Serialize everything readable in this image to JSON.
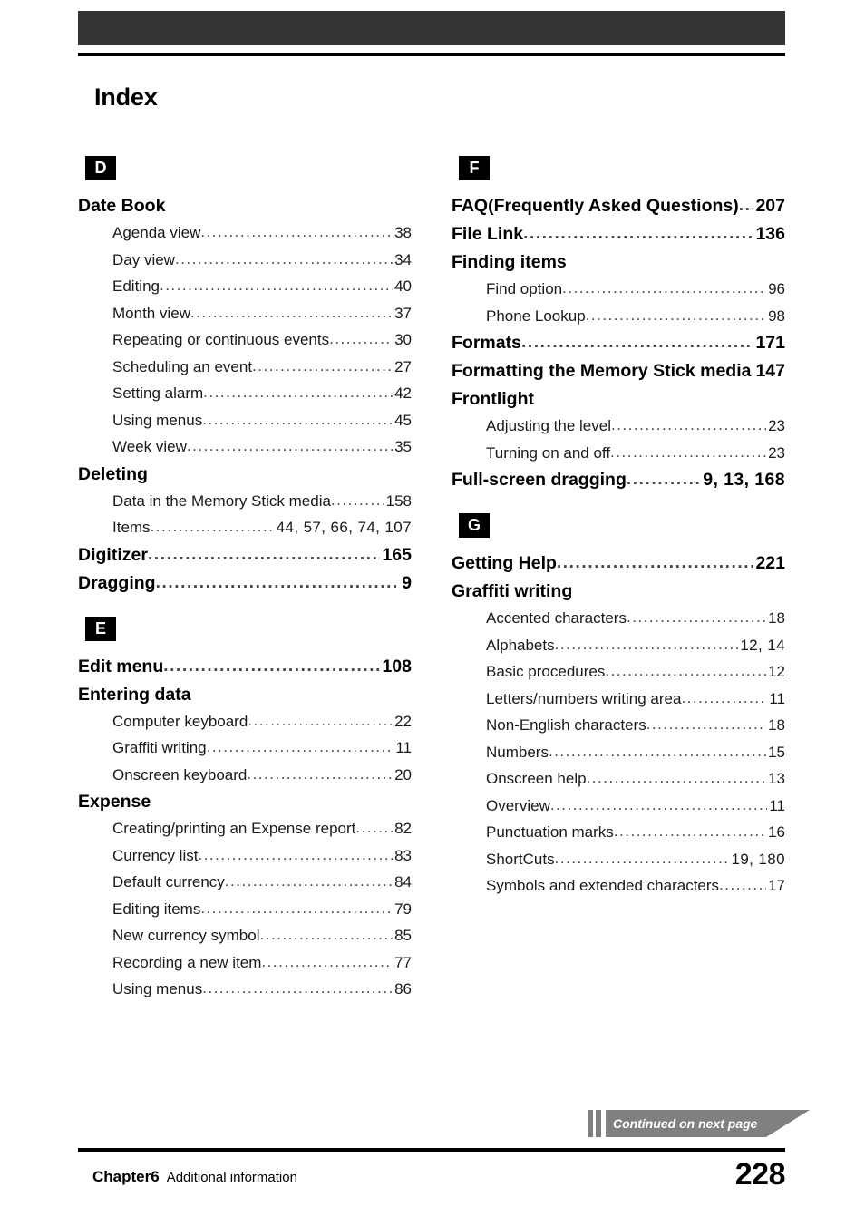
{
  "header": {
    "title": "Index"
  },
  "footer": {
    "chapter": "Chapter6",
    "chapter_subtitle": "Additional information",
    "page_number": "228",
    "continued_label": "Continued on next page"
  },
  "leader": "..................................................................................................",
  "columns": [
    {
      "groups": [
        {
          "letter": "D",
          "entries": [
            {
              "level": "main",
              "label": "Date Book",
              "pages": ""
            },
            {
              "level": "sub",
              "label": "Agenda view",
              "pages": "38"
            },
            {
              "level": "sub",
              "label": "Day view",
              "pages": "34"
            },
            {
              "level": "sub",
              "label": "Editing",
              "pages": "40"
            },
            {
              "level": "sub",
              "label": "Month view",
              "pages": "37"
            },
            {
              "level": "sub",
              "label": "Repeating or continuous events",
              "pages": "30"
            },
            {
              "level": "sub",
              "label": "Scheduling an event",
              "pages": "27"
            },
            {
              "level": "sub",
              "label": "Setting alarm",
              "pages": "42"
            },
            {
              "level": "sub",
              "label": "Using menus",
              "pages": "45"
            },
            {
              "level": "sub",
              "label": "Week view",
              "pages": "35"
            },
            {
              "level": "main",
              "label": "Deleting",
              "pages": ""
            },
            {
              "level": "sub",
              "label": "Data in the Memory Stick media",
              "pages": "158"
            },
            {
              "level": "sub",
              "label": "Items",
              "pages": "44,  57,  66,  74,  107"
            },
            {
              "level": "main",
              "label": "Digitizer",
              "pages": "165"
            },
            {
              "level": "main",
              "label": "Dragging",
              "pages": "9"
            }
          ]
        },
        {
          "letter": "E",
          "entries": [
            {
              "level": "main",
              "label": "Edit menu",
              "pages": "108"
            },
            {
              "level": "main",
              "label": "Entering data",
              "pages": ""
            },
            {
              "level": "sub",
              "label": "Computer keyboard",
              "pages": "22"
            },
            {
              "level": "sub",
              "label": "Graffiti writing",
              "pages": "11"
            },
            {
              "level": "sub",
              "label": "Onscreen keyboard",
              "pages": "20"
            },
            {
              "level": "main",
              "label": "Expense",
              "pages": ""
            },
            {
              "level": "sub",
              "label": "Creating/printing an Expense report",
              "pages": "82"
            },
            {
              "level": "sub",
              "label": "Currency list",
              "pages": "83"
            },
            {
              "level": "sub",
              "label": "Default currency",
              "pages": "84"
            },
            {
              "level": "sub",
              "label": "Editing items",
              "pages": "79"
            },
            {
              "level": "sub",
              "label": "New currency symbol",
              "pages": "85"
            },
            {
              "level": "sub",
              "label": "Recording a new item",
              "pages": "77"
            },
            {
              "level": "sub",
              "label": "Using menus",
              "pages": "86"
            }
          ]
        }
      ]
    },
    {
      "groups": [
        {
          "letter": "F",
          "entries": [
            {
              "level": "main",
              "label": "FAQ(Frequently Asked Questions)",
              "pages": "207"
            },
            {
              "level": "main",
              "label": "File Link",
              "pages": "136"
            },
            {
              "level": "main",
              "label": "Finding items",
              "pages": ""
            },
            {
              "level": "sub",
              "label": "Find option",
              "pages": "96"
            },
            {
              "level": "sub",
              "label": "Phone Lookup",
              "pages": "98"
            },
            {
              "level": "main",
              "label": "Formats",
              "pages": "171"
            },
            {
              "level": "main",
              "label": "Formatting the Memory Stick media",
              "pages": "147"
            },
            {
              "level": "main",
              "label": "Frontlight",
              "pages": ""
            },
            {
              "level": "sub",
              "label": "Adjusting the level",
              "pages": "23"
            },
            {
              "level": "sub",
              "label": "Turning on and off",
              "pages": "23"
            },
            {
              "level": "main",
              "label": "Full-screen dragging",
              "pages": "9,  13,  168"
            }
          ]
        },
        {
          "letter": "G",
          "entries": [
            {
              "level": "main",
              "label": "Getting Help",
              "pages": "221"
            },
            {
              "level": "main",
              "label": "Graffiti writing",
              "pages": ""
            },
            {
              "level": "sub",
              "label": "Accented characters",
              "pages": "18"
            },
            {
              "level": "sub",
              "label": "Alphabets",
              "pages": "12,  14"
            },
            {
              "level": "sub",
              "label": "Basic procedures",
              "pages": "12"
            },
            {
              "level": "sub",
              "label": "Letters/numbers writing area",
              "pages": "11"
            },
            {
              "level": "sub",
              "label": "Non-English characters",
              "pages": "18"
            },
            {
              "level": "sub",
              "label": "Numbers",
              "pages": "15"
            },
            {
              "level": "sub",
              "label": "Onscreen help",
              "pages": "13"
            },
            {
              "level": "sub",
              "label": "Overview",
              "pages": "11"
            },
            {
              "level": "sub",
              "label": "Punctuation marks",
              "pages": "16"
            },
            {
              "level": "sub",
              "label": "ShortCuts",
              "pages": "19,  180"
            },
            {
              "level": "sub",
              "label": "Symbols and extended characters",
              "pages": "17"
            }
          ]
        }
      ]
    }
  ]
}
